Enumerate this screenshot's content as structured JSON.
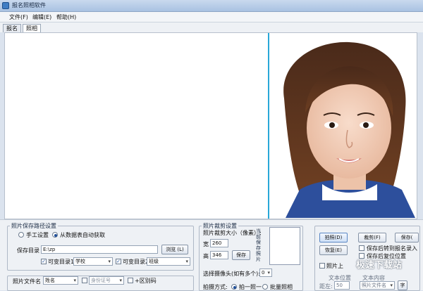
{
  "window": {
    "title": "报名照相软件"
  },
  "menu": [
    {
      "label": "文件(F)"
    },
    {
      "label": "编辑(E)"
    },
    {
      "label": "帮助(H)"
    }
  ],
  "tabs": [
    {
      "label": "报名"
    },
    {
      "label": "照相"
    }
  ],
  "path_group": {
    "legend": "照片保存路径设置",
    "radio_manual": "手工设置",
    "radio_auto": "从数据表自动获取",
    "save_dir_label": "保存目录",
    "save_dir_value": "E:\\zp",
    "browse_button": "浏览 (L)",
    "var_dir1_label": "可变目录1",
    "var_dir1_value": "学校",
    "var_dir2_label": "可变目录2",
    "var_dir2_value": "班级"
  },
  "filename_group": {
    "legend": "照片文件名",
    "name_value": "姓名",
    "id_value": "身份证号",
    "plus_label": "+区别码"
  },
  "crop_group": {
    "legend": "照片裁剪设置",
    "size_label": "照片裁剪大小（像素）:",
    "width_label": "宽",
    "width_value": "260",
    "height_label": "高",
    "height_value": "346",
    "save_button": "保存",
    "preview_label": "当前保存照片",
    "camera_label": "选择摄像头(如有多个):",
    "camera_value": "0",
    "mode_label": "拍摄方式:",
    "mode_single": "拍一照一",
    "mode_batch": "批量照相"
  },
  "actions": {
    "shoot_button": "拍照(D)",
    "crop_button": "裁剪(F)",
    "save_button": "保存(",
    "restore_button": "恢复(E)",
    "cb_turn_to_entry": "保存后转到报名录入",
    "cb_save_position": "保存后复位位置",
    "cb_photo_label": "照片上",
    "text_pos_label": "文本位置",
    "text_content_label": "文本内容",
    "text_pos_value": "50",
    "text_pos_prefix": "距左:",
    "text_content_value": "照片文件名",
    "small_button": "字"
  },
  "watermark": "极速下载站"
}
